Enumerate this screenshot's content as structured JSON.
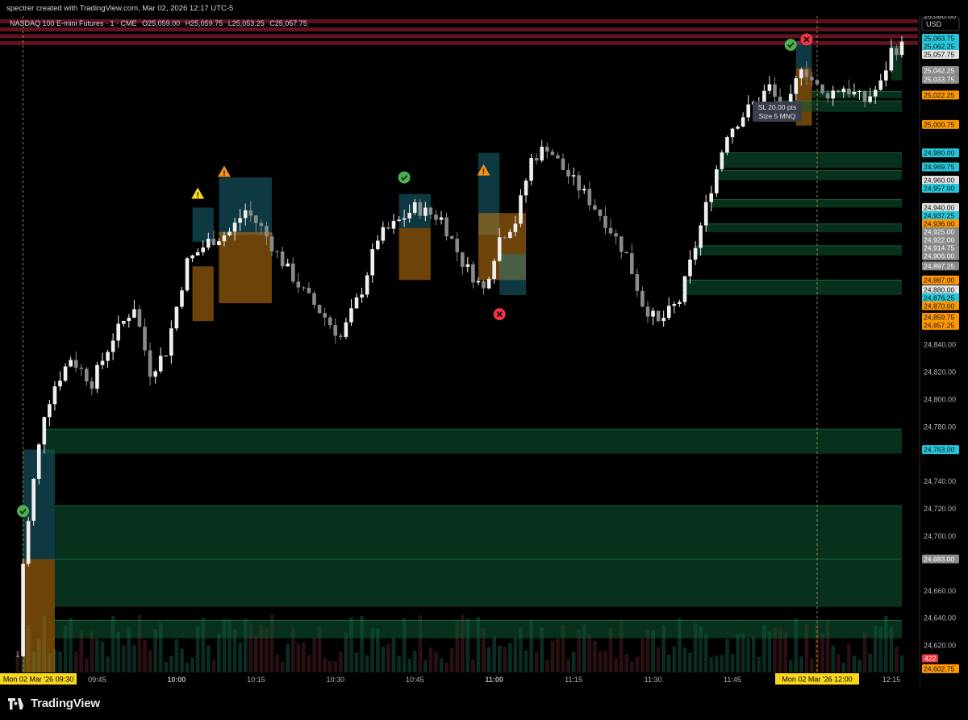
{
  "credit": "spectrer created with TradingView.com, Mar 02, 2026 12:17 UTC-5",
  "brand": "TradingView",
  "symbol_line": {
    "name": "NASDAQ 100 E-mini Futures · 1 · CME",
    "o_label": "O",
    "o_value": "25,059.00",
    "h_label": "H",
    "h_value": "25,059.75",
    "l_label": "L",
    "l_value": "25,053.25",
    "c_label": "C",
    "c_value": "25,057.75"
  },
  "currency": "USD",
  "countdown": "00:15",
  "position_tooltip": {
    "line1": "SL 20.00 pts",
    "line2": "Size 5 MNQ"
  },
  "volume_badge": "422",
  "colors": {
    "bull": "#f0f0f0",
    "bear": "#8a8a8a",
    "teal_zone": "#1e7f93",
    "orange_zone": "#c77a10",
    "green_zone": "#0f5a34",
    "red_line": "#b0243a",
    "badge_cyan": "#26c6da",
    "badge_orange": "#ff9800",
    "badge_gray": "#8a8a8a",
    "badge_white": "#e0e0e0",
    "signal_green": "#4caf50",
    "signal_red": "#f23645",
    "warn_yellow": "#f9d71c",
    "warn_orange": "#f5921b"
  },
  "chart_data": {
    "type": "candlestick",
    "title": "NASDAQ 100 E-mini Futures · 1 · CME",
    "timeframe": "1 minute",
    "ylim": [
      24600,
      25080
    ],
    "time_range": [
      "09:30",
      "12:17"
    ],
    "y_tick_labels": [
      "25,080.00",
      "24,840.00",
      "24,820.00",
      "24,800.00",
      "24,780.00",
      "24,740.00",
      "24,720.00",
      "24,700.00",
      "24,660.00",
      "24,640.00",
      "24,620.00"
    ],
    "x_tick_labels": [
      "09:45",
      "10:00",
      "10:15",
      "10:30",
      "10:45",
      "11:00",
      "11:15",
      "11:30",
      "11:45",
      "12:15"
    ],
    "x_highlight_labels": [
      "Mon 02 Mar '26  09:30",
      "Mon 02 Mar '26  12:00"
    ],
    "last_price": 25057.75,
    "price_path": [
      {
        "t": "09:30",
        "p": 24612
      },
      {
        "t": "09:31",
        "p": 24680
      },
      {
        "t": "09:33",
        "p": 24740
      },
      {
        "t": "09:35",
        "p": 24790
      },
      {
        "t": "09:37",
        "p": 24810
      },
      {
        "t": "09:40",
        "p": 24830
      },
      {
        "t": "09:44",
        "p": 24812
      },
      {
        "t": "09:48",
        "p": 24845
      },
      {
        "t": "09:52",
        "p": 24868
      },
      {
        "t": "09:55",
        "p": 24820
      },
      {
        "t": "09:58",
        "p": 24835
      },
      {
        "t": "10:02",
        "p": 24900
      },
      {
        "t": "10:06",
        "p": 24915
      },
      {
        "t": "10:10",
        "p": 24922
      },
      {
        "t": "10:13",
        "p": 24938
      },
      {
        "t": "10:16",
        "p": 24925
      },
      {
        "t": "10:20",
        "p": 24900
      },
      {
        "t": "10:24",
        "p": 24878
      },
      {
        "t": "10:28",
        "p": 24860
      },
      {
        "t": "10:31",
        "p": 24845
      },
      {
        "t": "10:35",
        "p": 24880
      },
      {
        "t": "10:38",
        "p": 24918
      },
      {
        "t": "10:42",
        "p": 24930
      },
      {
        "t": "10:45",
        "p": 24940
      },
      {
        "t": "10:50",
        "p": 24932
      },
      {
        "t": "10:54",
        "p": 24900
      },
      {
        "t": "10:58",
        "p": 24880
      },
      {
        "t": "11:01",
        "p": 24918
      },
      {
        "t": "11:04",
        "p": 24930
      },
      {
        "t": "11:07",
        "p": 24975
      },
      {
        "t": "11:10",
        "p": 24985
      },
      {
        "t": "11:13",
        "p": 24968
      },
      {
        "t": "11:17",
        "p": 24950
      },
      {
        "t": "11:21",
        "p": 24930
      },
      {
        "t": "11:25",
        "p": 24905
      },
      {
        "t": "11:28",
        "p": 24870
      },
      {
        "t": "11:31",
        "p": 24855
      },
      {
        "t": "11:35",
        "p": 24872
      },
      {
        "t": "11:38",
        "p": 24912
      },
      {
        "t": "11:41",
        "p": 24955
      },
      {
        "t": "11:44",
        "p": 24995
      },
      {
        "t": "11:48",
        "p": 25012
      },
      {
        "t": "11:52",
        "p": 25028
      },
      {
        "t": "11:55",
        "p": 25005
      },
      {
        "t": "11:58",
        "p": 25045
      },
      {
        "t": "12:02",
        "p": 25022
      },
      {
        "t": "12:06",
        "p": 25028
      },
      {
        "t": "12:10",
        "p": 25018
      },
      {
        "t": "12:13",
        "p": 25030
      },
      {
        "t": "12:15",
        "p": 25055
      },
      {
        "t": "12:17",
        "p": 25057.75
      }
    ],
    "price_badges": [
      {
        "label": "25,063.75",
        "value": 25063.75,
        "color": "cyan"
      },
      {
        "label": "25,062.25",
        "value": 25062.25,
        "color": "cyan"
      },
      {
        "label": "25,057.75",
        "value": 25057.75,
        "color": "white"
      },
      {
        "label": "25,042.25",
        "value": 25042.25,
        "color": "gray"
      },
      {
        "label": "25,033.75",
        "value": 25033.75,
        "color": "gray"
      },
      {
        "label": "25,022.25",
        "value": 25022.25,
        "color": "orange"
      },
      {
        "label": "25,000.75",
        "value": 25000.75,
        "color": "orange"
      },
      {
        "label": "24,980.00",
        "value": 24980.0,
        "color": "cyan"
      },
      {
        "label": "24,969.75",
        "value": 24969.75,
        "color": "cyan"
      },
      {
        "label": "24,960.00",
        "value": 24960.0,
        "color": "white"
      },
      {
        "label": "24,957.00",
        "value": 24957.0,
        "color": "cyan"
      },
      {
        "label": "24,940.00",
        "value": 24940.0,
        "color": "white"
      },
      {
        "label": "24,937.25",
        "value": 24937.25,
        "color": "cyan"
      },
      {
        "label": "24,936.00",
        "value": 24936.0,
        "color": "orange"
      },
      {
        "label": "24,925.00",
        "value": 24925.0,
        "color": "gray"
      },
      {
        "label": "24,922.00",
        "value": 24922.0,
        "color": "gray"
      },
      {
        "label": "24,914.75",
        "value": 24914.75,
        "color": "gray"
      },
      {
        "label": "24,906.00",
        "value": 24906.0,
        "color": "gray"
      },
      {
        "label": "24,897.25",
        "value": 24897.25,
        "color": "gray"
      },
      {
        "label": "24,887.00",
        "value": 24887.0,
        "color": "orange"
      },
      {
        "label": "24,880.00",
        "value": 24880.0,
        "color": "white"
      },
      {
        "label": "24,876.25",
        "value": 24876.25,
        "color": "cyan"
      },
      {
        "label": "24,870.00",
        "value": 24870.0,
        "color": "orange"
      },
      {
        "label": "24,859.75",
        "value": 24859.75,
        "color": "orange"
      },
      {
        "label": "24,857.25",
        "value": 24857.25,
        "color": "orange"
      },
      {
        "label": "24,763.00",
        "value": 24763.0,
        "color": "cyan"
      },
      {
        "label": "24,683.00",
        "value": 24683.0,
        "color": "gray"
      },
      {
        "label": "24,602.75",
        "value": 24602.75,
        "color": "orange"
      }
    ],
    "zones": [
      {
        "kind": "teal",
        "t0": "09:31",
        "t1": "09:37",
        "p0": 24683,
        "p1": 24763
      },
      {
        "kind": "orange",
        "t0": "09:31",
        "t1": "09:37",
        "p0": 24600,
        "p1": 24683
      },
      {
        "kind": "green",
        "t0": "09:35",
        "t1": "12:17",
        "p0": 24760,
        "p1": 24778
      },
      {
        "kind": "green",
        "t0": "09:37",
        "t1": "12:17",
        "p0": 24683,
        "p1": 24722
      },
      {
        "kind": "green",
        "t0": "09:37",
        "t1": "12:17",
        "p0": 24648,
        "p1": 24683
      },
      {
        "kind": "green",
        "t0": "09:37",
        "t1": "12:17",
        "p0": 24625,
        "p1": 24638
      },
      {
        "kind": "teal",
        "t0": "10:03",
        "t1": "10:07",
        "p0": 24915,
        "p1": 24940
      },
      {
        "kind": "orange",
        "t0": "10:03",
        "t1": "10:07",
        "p0": 24857,
        "p1": 24897
      },
      {
        "kind": "teal",
        "t0": "10:08",
        "t1": "10:18",
        "p0": 24920,
        "p1": 24962
      },
      {
        "kind": "orange",
        "t0": "10:08",
        "t1": "10:18",
        "p0": 24870,
        "p1": 24922
      },
      {
        "kind": "teal",
        "t0": "10:42",
        "t1": "10:48",
        "p0": 24925,
        "p1": 24950
      },
      {
        "kind": "orange",
        "t0": "10:42",
        "t1": "10:48",
        "p0": 24887,
        "p1": 24925
      },
      {
        "kind": "teal",
        "t0": "10:57",
        "t1": "11:01",
        "p0": 24920,
        "p1": 24980
      },
      {
        "kind": "orange",
        "t0": "10:57",
        "t1": "11:06",
        "p0": 24887,
        "p1": 24936
      },
      {
        "kind": "teal",
        "t0": "11:01",
        "t1": "11:06",
        "p0": 24876,
        "p1": 24906
      },
      {
        "kind": "green",
        "t0": "11:36",
        "t1": "12:17",
        "p0": 24876,
        "p1": 24887
      },
      {
        "kind": "green",
        "t0": "11:38",
        "t1": "12:17",
        "p0": 24905,
        "p1": 24912
      },
      {
        "kind": "green",
        "t0": "11:40",
        "t1": "12:17",
        "p0": 24922,
        "p1": 24928
      },
      {
        "kind": "green",
        "t0": "11:41",
        "t1": "12:17",
        "p0": 24940,
        "p1": 24946
      },
      {
        "kind": "green",
        "t0": "11:42",
        "t1": "12:17",
        "p0": 24960,
        "p1": 24967
      },
      {
        "kind": "green",
        "t0": "11:43",
        "t1": "12:17",
        "p0": 24969,
        "p1": 24980
      },
      {
        "kind": "teal",
        "t0": "11:57",
        "t1": "12:00",
        "p0": 25042,
        "p1": 25062
      },
      {
        "kind": "orange",
        "t0": "11:57",
        "t1": "12:00",
        "p0": 25000,
        "p1": 25042
      },
      {
        "kind": "green",
        "t0": "12:00",
        "t1": "12:17",
        "p0": 25020,
        "p1": 25025
      },
      {
        "kind": "green",
        "t0": "11:53",
        "t1": "12:17",
        "p0": 25010,
        "p1": 25018
      },
      {
        "kind": "green",
        "t0": "12:15",
        "t1": "12:17",
        "p0": 25033,
        "p1": 25058
      }
    ],
    "red_levels": [
      25076,
      25070,
      25065,
      25060
    ],
    "vertical_markers": [
      "09:31",
      "12:01"
    ],
    "signals": [
      {
        "type": "check",
        "t": "09:31",
        "p": 24718
      },
      {
        "type": "warn",
        "t": "10:04",
        "p": 24950
      },
      {
        "type": "warn",
        "t": "10:09",
        "p": 24966
      },
      {
        "type": "check",
        "t": "10:43",
        "p": 24962
      },
      {
        "type": "warn",
        "t": "10:58",
        "p": 24967
      },
      {
        "type": "x",
        "t": "11:01",
        "p": 24862
      },
      {
        "type": "check",
        "t": "11:56",
        "p": 25059
      },
      {
        "type": "x",
        "t": "11:59",
        "p": 25063
      }
    ]
  }
}
